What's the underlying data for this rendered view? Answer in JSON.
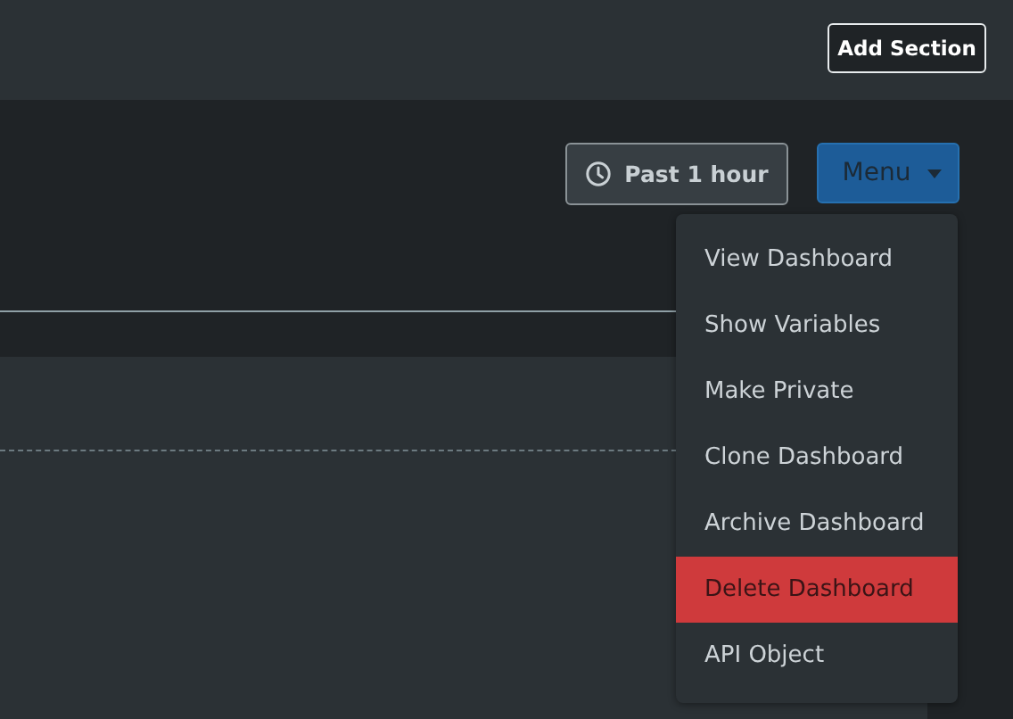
{
  "top_bar": {
    "add_section_button": "Add Section"
  },
  "toolbar": {
    "time_range_button": "Past 1 hour",
    "menu_button": {
      "label": "Menu",
      "expanded": true
    }
  },
  "menu_items": [
    {
      "label": "View Dashboard",
      "selected": false
    },
    {
      "label": "Show Variables",
      "selected": false
    },
    {
      "label": "Make Private",
      "selected": false
    },
    {
      "label": "Clone Dashboard",
      "selected": false
    },
    {
      "label": "Archive Dashboard",
      "selected": false
    },
    {
      "label": "Delete Dashboard",
      "selected": true
    },
    {
      "label": "API Object",
      "selected": false
    }
  ]
}
